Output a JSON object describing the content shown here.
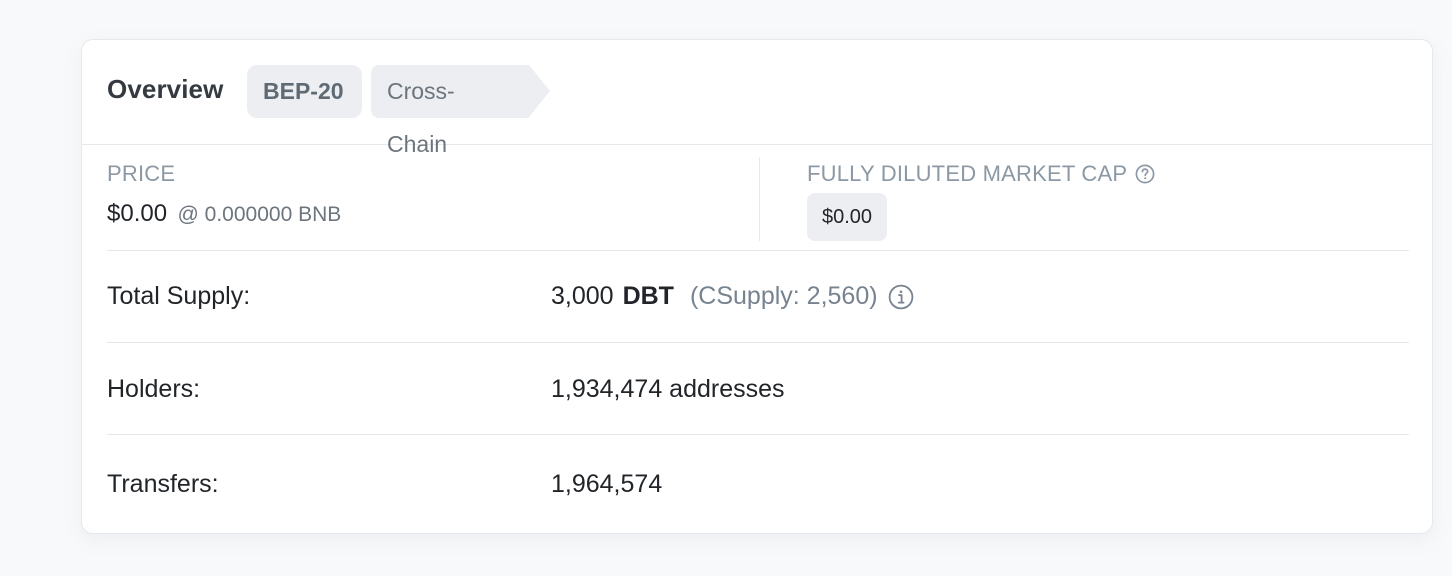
{
  "header": {
    "title": "Overview",
    "badges": [
      "BEP-20",
      "Cross-Chain"
    ]
  },
  "price": {
    "label": "PRICE",
    "usd": "$0.00",
    "bnb": "@ 0.000000 BNB"
  },
  "fdmc": {
    "label": "FULLY DILUTED MARKET CAP",
    "value": "$0.00",
    "help_icon": "question-circle-icon"
  },
  "rows": {
    "total_supply": {
      "label": "Total Supply:",
      "amount": "3,000",
      "symbol": "DBT",
      "csupply": "(CSupply: 2,560)",
      "info_icon": "info-circle-icon"
    },
    "holders": {
      "label": "Holders:",
      "value": "1,934,474 addresses"
    },
    "transfers": {
      "label": "Transfers:",
      "value": "1,964,574"
    }
  },
  "colors": {
    "background": "#f8f9fa",
    "card": "#ffffff",
    "badge_bg": "#eceef1",
    "muted_text": "#8c98a4",
    "border": "#e5e8ec"
  }
}
